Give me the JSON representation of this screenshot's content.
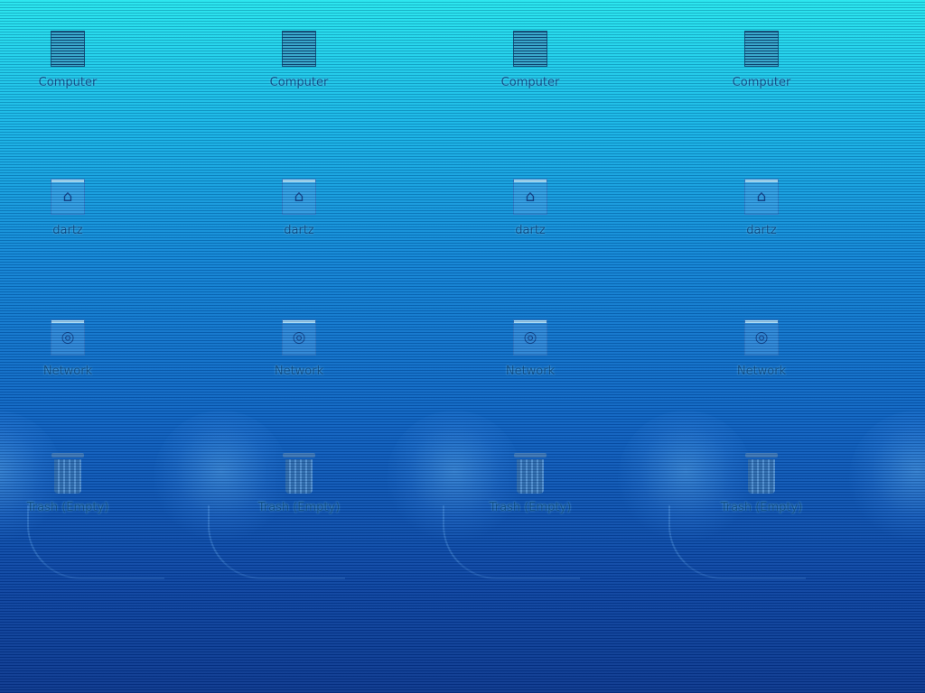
{
  "desktop": {
    "columns": [
      {
        "computer_label": "Computer",
        "home_label": "dartz",
        "network_label": "Network",
        "trash_label": "Trash (Empty)"
      },
      {
        "computer_label": "Computer",
        "home_label": "dartz",
        "network_label": "Network",
        "trash_label": "Trash (Empty)"
      },
      {
        "computer_label": "Computer",
        "home_label": "dartz",
        "network_label": "Network",
        "trash_label": "Trash (Empty)"
      },
      {
        "computer_label": "Computer",
        "home_label": "dartz",
        "network_label": "Network",
        "trash_label": "Trash (Empty)"
      }
    ],
    "icons": {
      "computer": "computer-icon",
      "home": "home-folder-icon",
      "network": "network-icon",
      "trash": "trash-icon"
    },
    "colors": {
      "wallpaper_top": "#22e6ee",
      "wallpaper_bottom": "#07358c",
      "label_text": "#0c4f8a"
    }
  }
}
